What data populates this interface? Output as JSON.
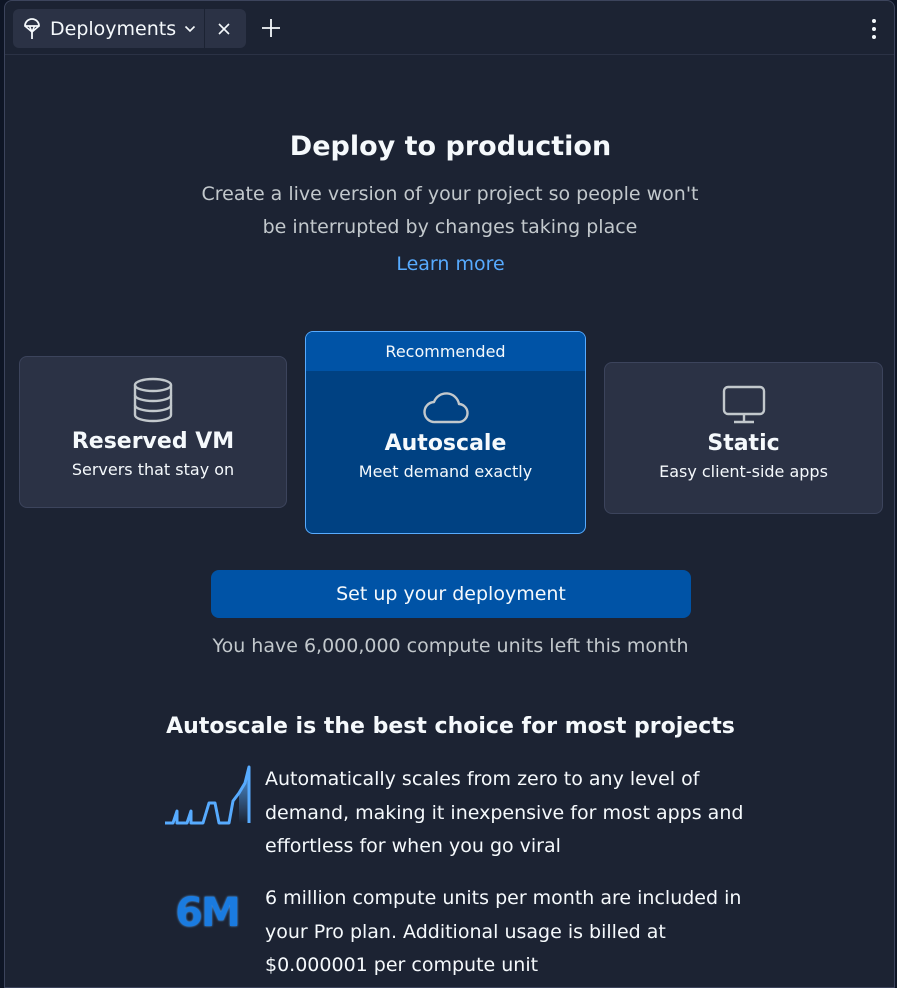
{
  "tab": {
    "title": "Deployments"
  },
  "hero": {
    "title": "Deploy to production",
    "subtitle": "Create a live version of your project so people won't be interrupted by changes taking place",
    "learn_more": "Learn more"
  },
  "options": {
    "reserved_vm": {
      "icon": "database-icon",
      "name": "Reserved VM",
      "desc": "Servers that stay on"
    },
    "autoscale": {
      "badge": "Recommended",
      "icon": "cloud-icon",
      "name": "Autoscale",
      "desc": "Meet demand exactly"
    },
    "static": {
      "icon": "monitor-icon",
      "name": "Static",
      "desc": "Easy client-side apps"
    }
  },
  "cta": {
    "label": "Set up your deployment"
  },
  "usage": {
    "text": "You have 6,000,000 compute units left this month"
  },
  "benefits": {
    "title": "Autoscale is the best choice for most projects",
    "items": [
      {
        "icon": "scaling-graph-icon",
        "text": "Automatically scales from zero to any level of demand, making it inexpensive for most apps and effortless for when you go viral"
      },
      {
        "icon_text": "6M",
        "text": "6 million compute units per month are included in your Pro plan. Additional usage is billed at $0.000001 per compute unit"
      }
    ]
  },
  "colors": {
    "background": "#1c2333",
    "card": "#2b3245",
    "selected_card": "#004182",
    "accent": "#0053a6",
    "link": "#57abff"
  }
}
